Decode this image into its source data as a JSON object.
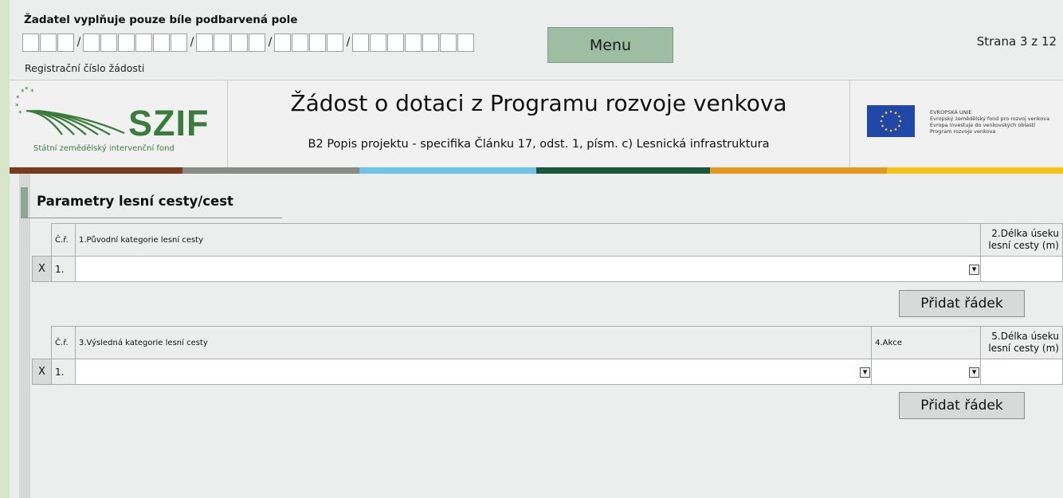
{
  "header": {
    "instruction": "Žadatel vyplňuje pouze bíle podbarvená pole",
    "reg_groups": [
      3,
      6,
      4,
      4,
      7
    ],
    "reg_separator": "/",
    "reg_label": "Registrační číslo žádosti",
    "menu_label": "Menu",
    "page_indicator": "Strana 3 z 12"
  },
  "banner": {
    "logo_text": "SZIF",
    "logo_subtext": "Státní zemědělský intervenční fond",
    "title": "Žádost o dotaci z Programu rozvoje venkova",
    "subtitle": "B2 Popis projektu - specifika Článku 17, odst. 1, písm. c) Lesnická infrastruktura",
    "eu_lines": [
      "EVROPSKÁ UNIE",
      "Evropský zemědělský fond pro rozvoj venkova",
      "Evropa investuje do venkovských oblastí",
      "Program rozvoje venkova"
    ],
    "color_stripes": [
      "#7a3a1e",
      "#8b8b86",
      "#6ec3e8",
      "#17573a",
      "#e39a1e",
      "#f5c21a"
    ]
  },
  "section": {
    "title": "Parametry lesní cesty/cest"
  },
  "table1": {
    "col_nr": "Č.ř.",
    "col_category": "1.Původní kategorie lesní cesty",
    "col_length": "2.Délka úseku lesní cesty (m)",
    "rows": [
      {
        "remove": "X",
        "nr": "1."
      }
    ],
    "add_label": "Přidat řádek"
  },
  "table2": {
    "col_nr": "Č.ř.",
    "col_category": "3.Výsledná kategorie lesní cesty",
    "col_action": "4.Akce",
    "col_length": "5.Délka úseku lesní cesty (m)",
    "rows": [
      {
        "remove": "X",
        "nr": "1."
      }
    ],
    "add_label": "Přidat řádek"
  }
}
